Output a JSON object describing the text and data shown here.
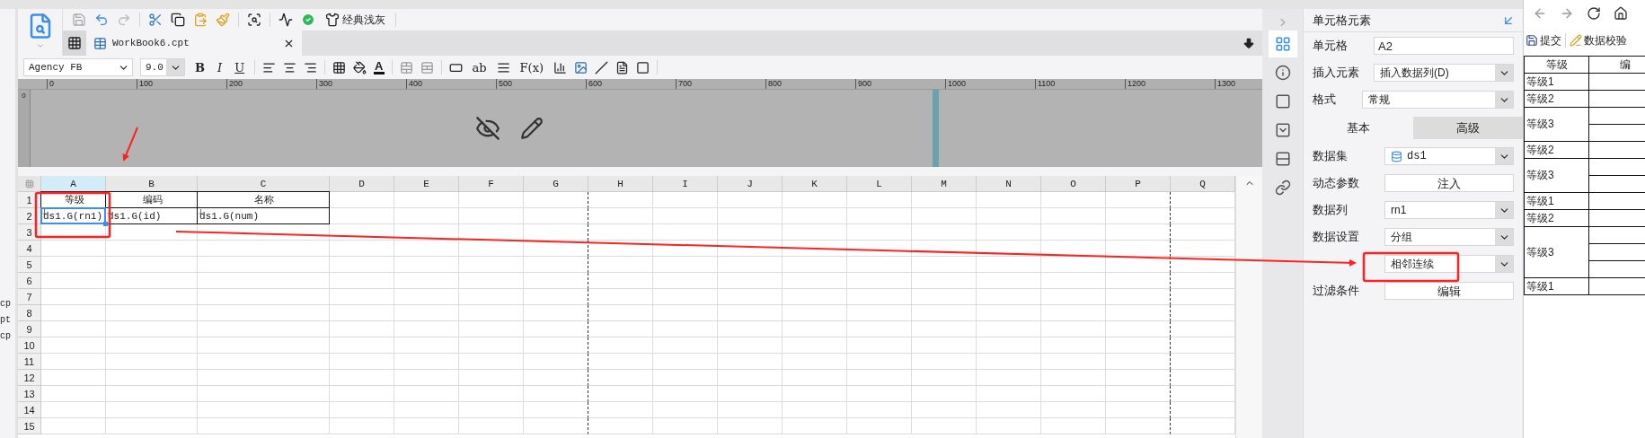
{
  "left_strip": {
    "items": [
      "cp",
      "pt",
      "cp"
    ]
  },
  "toolbar": {
    "theme_button": "经典浅灰"
  },
  "file_tab": {
    "label": "WorkBook6.cpt",
    "selected": true
  },
  "format_bar": {
    "font": "Agency FB",
    "size": "9.0",
    "bold": "B",
    "italic": "I",
    "underline": "U",
    "font_color": "A",
    "text_tool": "ab",
    "formula": "F(x)"
  },
  "ruler": {
    "marks": [
      "0",
      "100",
      "200",
      "300",
      "400",
      "500",
      "600",
      "700",
      "800",
      "900",
      "1000",
      "1100",
      "1200",
      "1300"
    ],
    "vertical_mark": "0"
  },
  "grid": {
    "columns": [
      {
        "label": "A",
        "selected": true,
        "page_break": false
      },
      {
        "label": "B",
        "selected": false,
        "page_break": false
      },
      {
        "label": "C",
        "selected": false,
        "page_break": false
      },
      {
        "label": "D",
        "selected": false,
        "page_break": false
      },
      {
        "label": "E",
        "selected": false,
        "page_break": false
      },
      {
        "label": "F",
        "selected": false,
        "page_break": false
      },
      {
        "label": "G",
        "selected": false,
        "page_break": true
      },
      {
        "label": "H",
        "selected": false,
        "page_break": false
      },
      {
        "label": "I",
        "selected": false,
        "page_break": false
      },
      {
        "label": "J",
        "selected": false,
        "page_break": false
      },
      {
        "label": "K",
        "selected": false,
        "page_break": false
      },
      {
        "label": "L",
        "selected": false,
        "page_break": false
      },
      {
        "label": "M",
        "selected": false,
        "page_break": false
      },
      {
        "label": "N",
        "selected": false,
        "page_break": false
      },
      {
        "label": "O",
        "selected": false,
        "page_break": false
      },
      {
        "label": "P",
        "selected": false,
        "page_break": true
      },
      {
        "label": "Q",
        "selected": false,
        "page_break": false
      }
    ],
    "rows": [
      {
        "number": "1",
        "cells": [
          {
            "text": "等级",
            "kind": "header",
            "selected": false
          },
          {
            "text": "编码",
            "kind": "header",
            "selected": false
          },
          {
            "text": "名称",
            "kind": "header",
            "selected": false
          }
        ]
      },
      {
        "number": "2",
        "cells": [
          {
            "text": "ds1.G(rn1)",
            "kind": "data",
            "selected": true
          },
          {
            "text": "ds1.G(id)",
            "kind": "data",
            "selected": false
          },
          {
            "text": "ds1.G(num)",
            "kind": "data",
            "selected": false
          }
        ]
      },
      {
        "number": "3"
      },
      {
        "number": "4"
      },
      {
        "number": "5"
      },
      {
        "number": "6"
      },
      {
        "number": "7"
      },
      {
        "number": "8"
      },
      {
        "number": "9"
      },
      {
        "number": "10"
      },
      {
        "number": "11"
      },
      {
        "number": "12"
      },
      {
        "number": "13"
      },
      {
        "number": "14"
      },
      {
        "number": "15"
      }
    ]
  },
  "side_tabs": [
    {
      "kind": "cell",
      "selected": true
    },
    {
      "kind": "info",
      "selected": false
    },
    {
      "kind": "border",
      "selected": false
    },
    {
      "kind": "widget",
      "selected": false
    },
    {
      "kind": "condition",
      "selected": false
    },
    {
      "kind": "link",
      "selected": false
    }
  ],
  "panel": {
    "title": "单元格元素",
    "fields": [
      {
        "kind": "input",
        "label": "单元格",
        "value": "A2"
      },
      {
        "kind": "select",
        "label": "插入元素",
        "value": "插入数据列(D)"
      },
      {
        "kind": "select",
        "label": "格式",
        "value": "常规"
      }
    ],
    "tabs": [
      {
        "label": "基本",
        "selected": true
      },
      {
        "label": "高级",
        "selected": false
      }
    ],
    "settings": [
      {
        "kind": "dataset",
        "label": "数据集",
        "value": "ds1"
      },
      {
        "kind": "button",
        "label": "动态参数",
        "value": "注入"
      },
      {
        "kind": "select",
        "label": "数据列",
        "value": "rn1"
      },
      {
        "kind": "select",
        "label": "数据设置",
        "value": "分组"
      },
      {
        "kind": "select",
        "value": "相邻连续"
      },
      {
        "kind": "button",
        "label": "过滤条件",
        "value": "编辑"
      }
    ]
  },
  "preview": {
    "actions": [
      "提交",
      "数据校验"
    ],
    "columns": [
      "等级",
      "编"
    ],
    "rows": [
      {
        "label": "等级1",
        "kind": "single"
      },
      {
        "label": "等级2",
        "kind": "single"
      },
      {
        "label": "等级3",
        "kind": "double"
      },
      {
        "label": "等级2",
        "kind": "single"
      },
      {
        "label": "等级3",
        "kind": "double"
      },
      {
        "label": "等级1",
        "kind": "single"
      },
      {
        "label": "等级2",
        "kind": "single"
      },
      {
        "label": "等级3",
        "kind": "triple"
      },
      {
        "label": "等级1",
        "kind": "single"
      }
    ]
  }
}
